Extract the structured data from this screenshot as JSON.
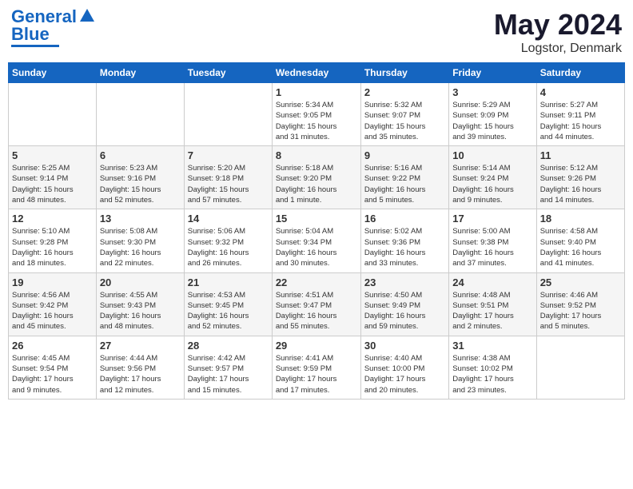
{
  "logo": {
    "line1": "General",
    "line2": "Blue"
  },
  "title": "May 2024",
  "location": "Logstor, Denmark",
  "days_of_week": [
    "Sunday",
    "Monday",
    "Tuesday",
    "Wednesday",
    "Thursday",
    "Friday",
    "Saturday"
  ],
  "weeks": [
    [
      {
        "day": "",
        "info": ""
      },
      {
        "day": "",
        "info": ""
      },
      {
        "day": "",
        "info": ""
      },
      {
        "day": "1",
        "info": "Sunrise: 5:34 AM\nSunset: 9:05 PM\nDaylight: 15 hours\nand 31 minutes."
      },
      {
        "day": "2",
        "info": "Sunrise: 5:32 AM\nSunset: 9:07 PM\nDaylight: 15 hours\nand 35 minutes."
      },
      {
        "day": "3",
        "info": "Sunrise: 5:29 AM\nSunset: 9:09 PM\nDaylight: 15 hours\nand 39 minutes."
      },
      {
        "day": "4",
        "info": "Sunrise: 5:27 AM\nSunset: 9:11 PM\nDaylight: 15 hours\nand 44 minutes."
      }
    ],
    [
      {
        "day": "5",
        "info": "Sunrise: 5:25 AM\nSunset: 9:14 PM\nDaylight: 15 hours\nand 48 minutes."
      },
      {
        "day": "6",
        "info": "Sunrise: 5:23 AM\nSunset: 9:16 PM\nDaylight: 15 hours\nand 52 minutes."
      },
      {
        "day": "7",
        "info": "Sunrise: 5:20 AM\nSunset: 9:18 PM\nDaylight: 15 hours\nand 57 minutes."
      },
      {
        "day": "8",
        "info": "Sunrise: 5:18 AM\nSunset: 9:20 PM\nDaylight: 16 hours\nand 1 minute."
      },
      {
        "day": "9",
        "info": "Sunrise: 5:16 AM\nSunset: 9:22 PM\nDaylight: 16 hours\nand 5 minutes."
      },
      {
        "day": "10",
        "info": "Sunrise: 5:14 AM\nSunset: 9:24 PM\nDaylight: 16 hours\nand 9 minutes."
      },
      {
        "day": "11",
        "info": "Sunrise: 5:12 AM\nSunset: 9:26 PM\nDaylight: 16 hours\nand 14 minutes."
      }
    ],
    [
      {
        "day": "12",
        "info": "Sunrise: 5:10 AM\nSunset: 9:28 PM\nDaylight: 16 hours\nand 18 minutes."
      },
      {
        "day": "13",
        "info": "Sunrise: 5:08 AM\nSunset: 9:30 PM\nDaylight: 16 hours\nand 22 minutes."
      },
      {
        "day": "14",
        "info": "Sunrise: 5:06 AM\nSunset: 9:32 PM\nDaylight: 16 hours\nand 26 minutes."
      },
      {
        "day": "15",
        "info": "Sunrise: 5:04 AM\nSunset: 9:34 PM\nDaylight: 16 hours\nand 30 minutes."
      },
      {
        "day": "16",
        "info": "Sunrise: 5:02 AM\nSunset: 9:36 PM\nDaylight: 16 hours\nand 33 minutes."
      },
      {
        "day": "17",
        "info": "Sunrise: 5:00 AM\nSunset: 9:38 PM\nDaylight: 16 hours\nand 37 minutes."
      },
      {
        "day": "18",
        "info": "Sunrise: 4:58 AM\nSunset: 9:40 PM\nDaylight: 16 hours\nand 41 minutes."
      }
    ],
    [
      {
        "day": "19",
        "info": "Sunrise: 4:56 AM\nSunset: 9:42 PM\nDaylight: 16 hours\nand 45 minutes."
      },
      {
        "day": "20",
        "info": "Sunrise: 4:55 AM\nSunset: 9:43 PM\nDaylight: 16 hours\nand 48 minutes."
      },
      {
        "day": "21",
        "info": "Sunrise: 4:53 AM\nSunset: 9:45 PM\nDaylight: 16 hours\nand 52 minutes."
      },
      {
        "day": "22",
        "info": "Sunrise: 4:51 AM\nSunset: 9:47 PM\nDaylight: 16 hours\nand 55 minutes."
      },
      {
        "day": "23",
        "info": "Sunrise: 4:50 AM\nSunset: 9:49 PM\nDaylight: 16 hours\nand 59 minutes."
      },
      {
        "day": "24",
        "info": "Sunrise: 4:48 AM\nSunset: 9:51 PM\nDaylight: 17 hours\nand 2 minutes."
      },
      {
        "day": "25",
        "info": "Sunrise: 4:46 AM\nSunset: 9:52 PM\nDaylight: 17 hours\nand 5 minutes."
      }
    ],
    [
      {
        "day": "26",
        "info": "Sunrise: 4:45 AM\nSunset: 9:54 PM\nDaylight: 17 hours\nand 9 minutes."
      },
      {
        "day": "27",
        "info": "Sunrise: 4:44 AM\nSunset: 9:56 PM\nDaylight: 17 hours\nand 12 minutes."
      },
      {
        "day": "28",
        "info": "Sunrise: 4:42 AM\nSunset: 9:57 PM\nDaylight: 17 hours\nand 15 minutes."
      },
      {
        "day": "29",
        "info": "Sunrise: 4:41 AM\nSunset: 9:59 PM\nDaylight: 17 hours\nand 17 minutes."
      },
      {
        "day": "30",
        "info": "Sunrise: 4:40 AM\nSunset: 10:00 PM\nDaylight: 17 hours\nand 20 minutes."
      },
      {
        "day": "31",
        "info": "Sunrise: 4:38 AM\nSunset: 10:02 PM\nDaylight: 17 hours\nand 23 minutes."
      },
      {
        "day": "",
        "info": ""
      }
    ]
  ]
}
